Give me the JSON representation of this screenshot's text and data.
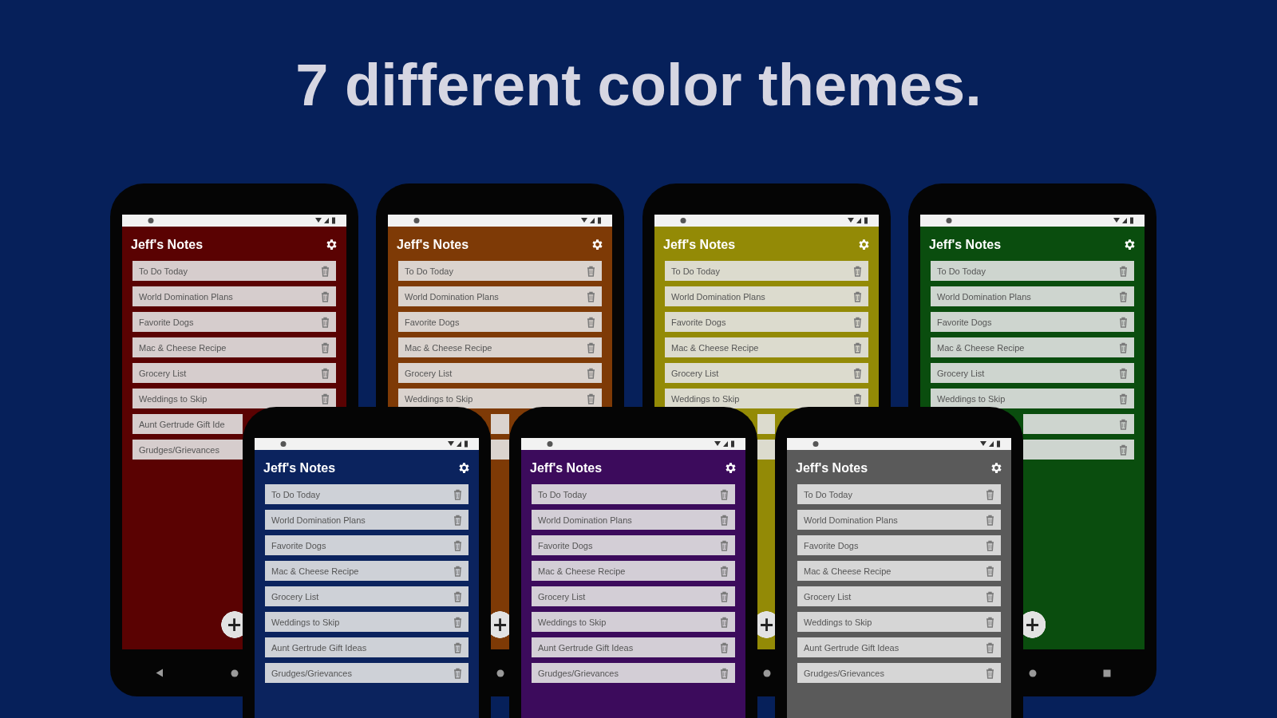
{
  "headline": "7 different color themes.",
  "phones": [
    {
      "color": "#5a0202",
      "app_title": "Jeff's Notes",
      "fab": "+",
      "notes": [
        {
          "kind": "note",
          "label": "To Do Today"
        },
        {
          "kind": "note",
          "label": "World Domination Plans"
        },
        {
          "kind": "note",
          "label": "Favorite Dogs"
        },
        {
          "kind": "note",
          "label": "Mac & Cheese Recipe"
        },
        {
          "kind": "note",
          "label": "Grocery List"
        },
        {
          "kind": "note",
          "label": "Weddings to Skip"
        },
        {
          "kind": "head",
          "label": "Aunt Gertrude Gift Ide"
        },
        {
          "kind": "head",
          "label": "Grudges/Grievances"
        }
      ]
    },
    {
      "color": "#7e3a06",
      "app_title": "Jeff's Notes",
      "fab": "+",
      "notes": [
        {
          "kind": "note",
          "label": "To Do Today"
        },
        {
          "kind": "note",
          "label": "World Domination Plans"
        },
        {
          "kind": "note",
          "label": "Favorite Dogs"
        },
        {
          "kind": "note",
          "label": "Mac & Cheese Recipe"
        },
        {
          "kind": "note",
          "label": "Grocery List"
        },
        {
          "kind": "note",
          "label": "Weddings to Skip"
        },
        {
          "kind": "stub"
        },
        {
          "kind": "stub"
        }
      ]
    },
    {
      "color": "#938a06",
      "app_title": "Jeff's Notes",
      "fab": "+",
      "notes": [
        {
          "kind": "note",
          "label": "To Do Today"
        },
        {
          "kind": "note",
          "label": "World Domination Plans"
        },
        {
          "kind": "note",
          "label": "Favorite Dogs"
        },
        {
          "kind": "note",
          "label": "Mac & Cheese Recipe"
        },
        {
          "kind": "note",
          "label": "Grocery List"
        },
        {
          "kind": "note",
          "label": "Weddings to Skip"
        },
        {
          "kind": "stub"
        },
        {
          "kind": "stub"
        }
      ]
    },
    {
      "color": "#0a4d0e",
      "app_title": "Jeff's Notes",
      "fab": "+",
      "notes": [
        {
          "kind": "note",
          "label": "To Do Today"
        },
        {
          "kind": "note",
          "label": "World Domination Plans"
        },
        {
          "kind": "note",
          "label": "Favorite Dogs"
        },
        {
          "kind": "note",
          "label": "Mac & Cheese Recipe"
        },
        {
          "kind": "note",
          "label": "Grocery List"
        },
        {
          "kind": "note",
          "label": "Weddings to Skip"
        },
        {
          "kind": "tail"
        },
        {
          "kind": "tail"
        }
      ]
    },
    {
      "color": "#0b235e",
      "app_title": "Jeff's Notes",
      "notes": [
        {
          "kind": "note",
          "label": "To Do Today"
        },
        {
          "kind": "note",
          "label": "World Domination Plans"
        },
        {
          "kind": "note",
          "label": "Favorite Dogs"
        },
        {
          "kind": "note",
          "label": "Mac & Cheese Recipe"
        },
        {
          "kind": "note",
          "label": "Grocery List"
        },
        {
          "kind": "note",
          "label": "Weddings to Skip"
        },
        {
          "kind": "note",
          "label": "Aunt Gertrude Gift Ideas"
        },
        {
          "kind": "note",
          "label": "Grudges/Grievances"
        }
      ]
    },
    {
      "color": "#3c0b5c",
      "app_title": "Jeff's Notes",
      "notes": [
        {
          "kind": "note",
          "label": "To Do Today"
        },
        {
          "kind": "note",
          "label": "World Domination Plans"
        },
        {
          "kind": "note",
          "label": "Favorite Dogs"
        },
        {
          "kind": "note",
          "label": "Mac & Cheese Recipe"
        },
        {
          "kind": "note",
          "label": "Grocery List"
        },
        {
          "kind": "note",
          "label": "Weddings to Skip"
        },
        {
          "kind": "note",
          "label": "Aunt Gertrude Gift Ideas"
        },
        {
          "kind": "note",
          "label": "Grudges/Grievances"
        }
      ]
    },
    {
      "color": "#5a5a5a",
      "app_title": "Jeff's Notes",
      "notes": [
        {
          "kind": "note",
          "label": "To Do Today"
        },
        {
          "kind": "note",
          "label": "World Domination Plans"
        },
        {
          "kind": "note",
          "label": "Favorite Dogs"
        },
        {
          "kind": "note",
          "label": "Mac & Cheese Recipe"
        },
        {
          "kind": "note",
          "label": "Grocery List"
        },
        {
          "kind": "note",
          "label": "Weddings to Skip"
        },
        {
          "kind": "note",
          "label": "Aunt Gertrude Gift Ideas"
        },
        {
          "kind": "note",
          "label": "Grudges/Grievances"
        }
      ]
    }
  ]
}
